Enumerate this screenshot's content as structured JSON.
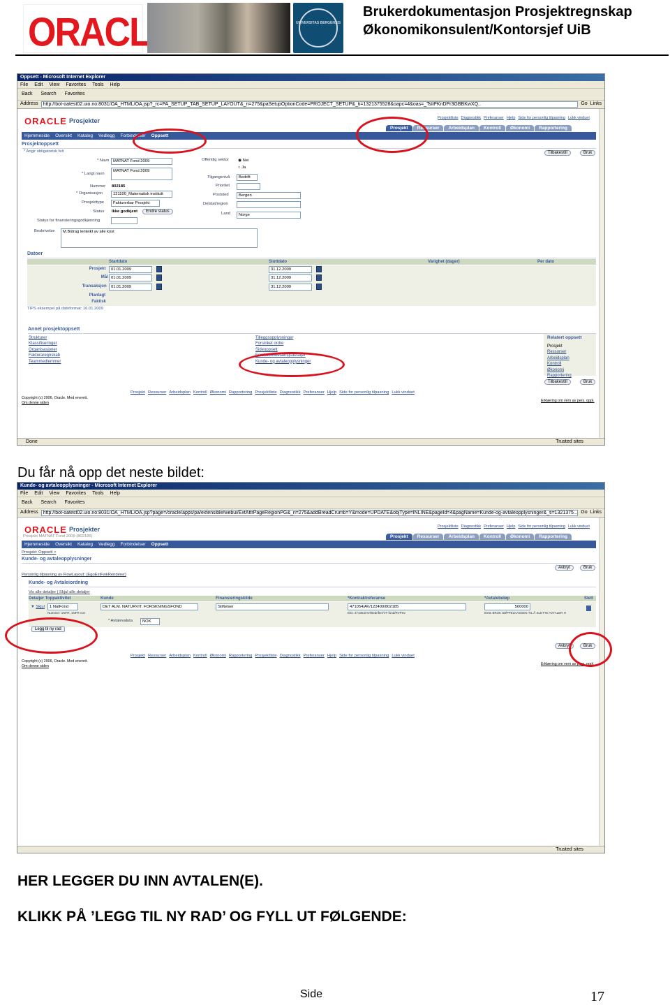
{
  "header": {
    "title_line1": "Brukerdokumentasjon Prosjektregnskap",
    "title_line2": "Økonomikonsulent/Kontorsjef UiB",
    "oracle_logo": "ORACLE",
    "seal_text": "UNIVERSITAS BERGENSIS"
  },
  "shot1": {
    "window_title": "Oppsett - Microsoft Internet Explorer",
    "menu": [
      "File",
      "Edit",
      "View",
      "Favorites",
      "Tools",
      "Help"
    ],
    "toolbar": [
      "Back",
      "Search",
      "Favorites"
    ],
    "address_label": "Address",
    "url": "http://bot-oatest02.uio.no:8031/OA_HTML/OA.jsp?_rc=PA_SETUP_TAB_SETUP_LAYOUT&_ri=275&paSetupOptionCode=PROJECT_SETUP&_ti=1321375528&oapc=4&oas=_TsliPKnDPr3GBBKwXQ..",
    "go": "Go",
    "links": "Links",
    "app_name": "Prosjekter",
    "top_links": [
      "Prosjektliste",
      "Diagnostikk",
      "Preferanser",
      "Hjelp",
      "Side for personlig tilpasning",
      "Lukk vinduet"
    ],
    "tabs": [
      "Prosjekt",
      "Ressurser",
      "Arbeidsplan",
      "Kontroll",
      "Økonomi",
      "Rapportering"
    ],
    "nav": [
      "Hjemmeside",
      "Oversikt",
      "Katalog",
      "Vedlegg",
      "Forbindelser",
      "Oppsett"
    ],
    "section_title": "Prosjektoppsett",
    "required_note": "* Angir obligatorisk felt",
    "btn_back": "Tilbakestill",
    "btn_apply": "Bruk",
    "labels": {
      "name": "* Navn",
      "long_name": "* Langt navn",
      "number": "Nummer",
      "org": "* Organisasjon",
      "type": "Prosjekttype",
      "status": "Status",
      "fin_status": "Status for finansieringsgodkjenning",
      "desc": "Beskrivelse",
      "public": "Offentlig sektor",
      "access": "Tilgangsnivå",
      "priority": "Prioritet",
      "postal": "Poststed",
      "region": "Delstat/region",
      "country": "Land"
    },
    "values": {
      "name": "MATNAT Fond 2009",
      "long_name": "MATNAT Fond 2009",
      "number": "802185",
      "org": "121100_Matematisk institutt",
      "type": "Fakturerbar Prosjekt",
      "status": "Ikke godkjent",
      "change_status": "Endre status",
      "desc": "M.Bidrag lenteikt av alle kost",
      "public_no": "Nei",
      "public_yes": "Ja",
      "access": "Bedrift",
      "postal": "Bergen",
      "country": "Norge"
    },
    "dates_title": "Datoer",
    "date_cols": [
      "Startdato",
      "Sluttdato",
      "Varighet (dager)",
      "Per dato"
    ],
    "date_rows": [
      {
        "label": "Prosjekt",
        "start": "01.01.2009",
        "end": "31.12.2009"
      },
      {
        "label": "Mål",
        "start": "01.01.2009",
        "end": "31.12.2009"
      },
      {
        "label": "Transaksjon",
        "start": "01.01.2009",
        "end": "31.12.2009"
      },
      {
        "label": "Planlagt",
        "start": "",
        "end": ""
      },
      {
        "label": "Faktisk",
        "start": "",
        "end": ""
      }
    ],
    "tip": "TIPS eksempel på datoformat: 16.01.2009",
    "other_setup_title": "Annet prosjektoppsett",
    "other_left": [
      "Strukturer",
      "Klassifiseringer",
      "Organisasjoner",
      "Fakturaregnskab",
      "Teammedlemmer"
    ],
    "other_mid": [
      "Tilleggsopplysninger",
      "Forsinket ordre",
      "Sideoppsett",
      "Forskuddsbetalingsdetaljer",
      "Kunde- og avtaleopplysninger"
    ],
    "related_title": "Relatert oppsett",
    "related_items": [
      "Prosjekt",
      "Ressurser",
      "Arbeidsplan",
      "Kontroll",
      "Økonomi",
      "Rapportering"
    ],
    "footer_links": [
      "Prosjekt",
      "Ressurser",
      "Arbeidsplan",
      "Kontroll",
      "Økonomi",
      "Rapportering",
      "Prosjektliste",
      "Diagnostikk",
      "Preferanser",
      "Hjelp",
      "Side for personlig tilpasning",
      "Lukk vinduet"
    ],
    "copyright": "Copyright (c) 2006, Oracle. Med enerett.",
    "about": "Om denne siden",
    "privacy": "Erklæring om vern av pers. oppl.",
    "status_done": "Done",
    "status_trusted": "Trusted sites"
  },
  "caption1": "Du får nå opp det neste bildet:",
  "shot2": {
    "window_title": "Kunde- og avtaleopplysninger - Microsoft Internet Explorer",
    "url": "http://bot-oatest02.uio.no:8031/OA_HTML/OA.jsp?page=/oracle/apps/pa/extensible/webui/ExtAttrPageRegionPG&_ri=275&addBreadCrumb=Y&mode=UPDATE&objType=INLINE&pageId=4&pagName=Kunde-og-avtaleopplysninger&_ti=1321375...",
    "subtitle": "Prosjekt MATNAT Fond 2009 (802185)",
    "breadcrumb": "Prosjekt: Oppsett  >",
    "page_title": "Kunde- og avtaleopplysninger",
    "btn_cancel": "Avbryt",
    "btn_apply": "Bruk",
    "personal": "Personlig tilpasning av FlowLayout: (EgoExtFwkRenderer)",
    "section": "Kunde- og Avtaleiordning",
    "show_hide": "Vis alle detaljer | Skjul alle detaljer",
    "cols": [
      "Detaljer Toppaktivitet",
      "Kunde",
      "Finansieringskilde",
      "*Kontraktreferanse",
      "*Avtalebeløp",
      "Slett"
    ],
    "row": {
      "hide": "Skjul",
      "activity": "1 NatFond",
      "activity_note": "Nummer: 1NFR, 1NFR nov",
      "customer": "DET ALM. NATURVIT. FORSKNINGSFOND",
      "funding": "Stiftelser",
      "contract": "471054/AV/122400/802185",
      "contract_note": "Eks: 471054/AV/Bedrifter/VT-fund/RVPSv",
      "amount": "500000",
      "amount_note": "IKKE BRUK SØPPELKASSEN TIL Å SLETTE AVTALER !!!",
      "currency_label": "* Avtalevaluta",
      "currency": "NOK"
    },
    "add_row": "Legg til ny rad"
  },
  "instruction1": "HER LEGGER DU INN AVTALEN(E).",
  "instruction2": "KLIKK PÅ ’LEGG TIL NY RAD’ OG FYLL UT FØLGENDE:",
  "footer": {
    "side_label": "Side",
    "page_number": "17"
  }
}
